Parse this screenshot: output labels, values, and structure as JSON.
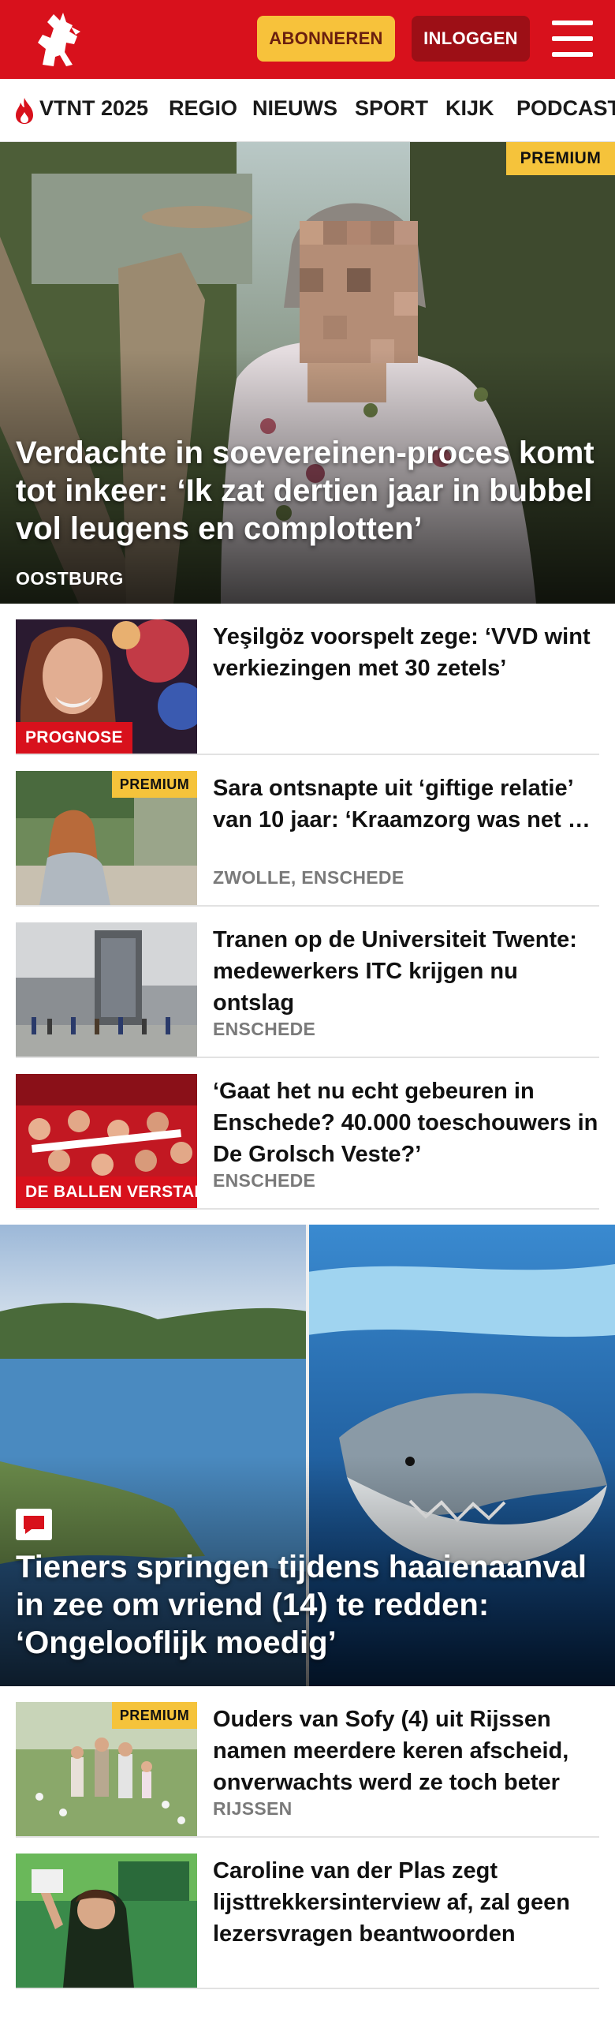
{
  "header": {
    "subscribe_label": "ABONNEREN",
    "login_label": "INLOGGEN",
    "brand_color": "#d8111c",
    "subscribe_color": "#f7c23b"
  },
  "nav": {
    "items": [
      {
        "label": "VTNT 2025",
        "icon": "flame-icon"
      },
      {
        "label": "REGIO"
      },
      {
        "label": "NIEUWS"
      },
      {
        "label": "SPORT"
      },
      {
        "label": "KIJK"
      },
      {
        "label": "PODCAST"
      }
    ]
  },
  "hero": {
    "badge": "PREMIUM",
    "title": "Verdachte in soevereinen-proces komt tot inkeer: ‘Ik zat dertien jaar in bubbel vol leugens en complotten’",
    "location": "OOSTBURG"
  },
  "articles": [
    {
      "title": "Yeşilgöz voorspelt zege: ‘VVD wint verkiezingen met 30 zetels’",
      "label": "PROGNOSE",
      "location": ""
    },
    {
      "title": "Sara ontsnapte uit ‘giftige relatie’ van 10 jaar: ‘Kraamzorg was net de deur uit, toen brak hij los’",
      "badge": "PREMIUM",
      "location": "ZWOLLE, ENSCHEDE"
    },
    {
      "title": "Tranen op de Universiteit Twente: medewerkers ITC krijgen nu ontslag",
      "location": "ENSCHEDE"
    },
    {
      "title": "‘Gaat het nu echt gebeuren in Enschede? 40.000 toeschouwers in De Grolsch Veste?’",
      "label": "DE BALLEN VERSTAND",
      "location": "ENSCHEDE"
    }
  ],
  "hero2": {
    "title": "Tieners springen tijdens haaienaanval in zee om vriend (14) te redden: ‘Ongelooflijk moedig’",
    "icon": "comment-icon"
  },
  "articles2": [
    {
      "title": "Ouders van Sofy (4) uit Rijssen namen meerdere keren afscheid, onverwachts werd ze toch beter",
      "badge": "PREMIUM",
      "location": "RIJSSEN"
    },
    {
      "title": "Caroline van der Plas zegt lijsttrekkersinterview af, zal geen lezersvragen beantwoorden",
      "location": ""
    }
  ]
}
